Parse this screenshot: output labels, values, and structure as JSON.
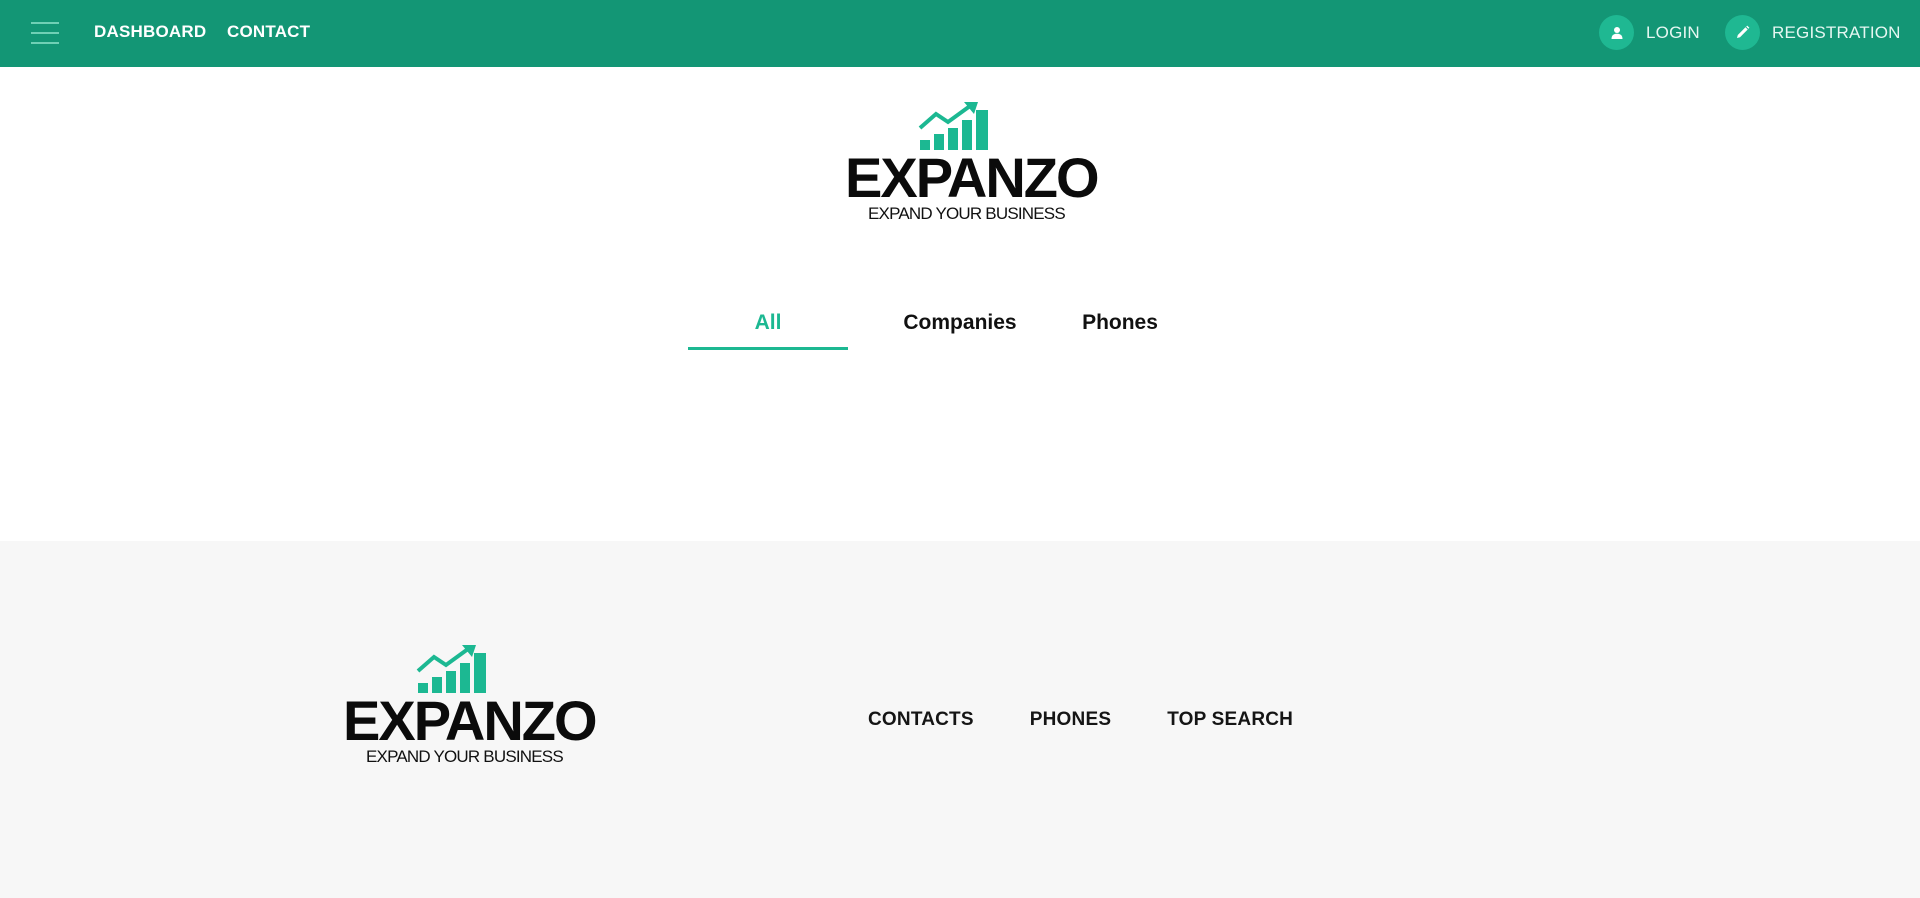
{
  "nav": {
    "dashboard_label": "DASHBOARD",
    "contact_label": "CONTACT",
    "login_label": "LOGIN",
    "registration_label": "REGISTRATION"
  },
  "brand": {
    "name": "EXPANZO",
    "tagline": "EXPAND YOUR BUSINESS",
    "accent_color": "#1cb892",
    "header_color": "#139675"
  },
  "tabs": [
    {
      "label": "All",
      "active": true
    },
    {
      "label": "Companies",
      "active": false
    },
    {
      "label": "Phones",
      "active": false
    }
  ],
  "footer": {
    "links": [
      "CONTACTS",
      "PHONES",
      "TOP SEARCH"
    ]
  },
  "icons": {
    "menu": "hamburger-menu-icon",
    "login": "user-icon",
    "registration": "pencil-icon",
    "logo_mark": "growth-chart-icon"
  }
}
